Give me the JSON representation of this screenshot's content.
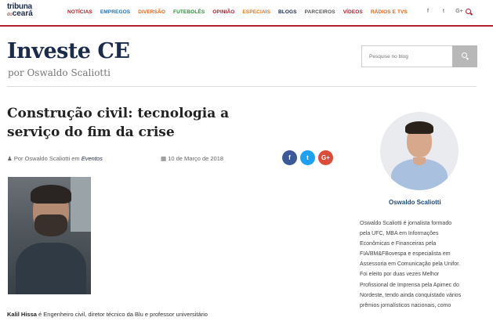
{
  "logo": {
    "line1": "tribuna",
    "line2_small": "do",
    "line2": "ceará"
  },
  "nav": [
    {
      "label": "NOTÍCIAS",
      "color": "#b2202b"
    },
    {
      "label": "EMPREGOS",
      "color": "#1f6fb5"
    },
    {
      "label": "DIVERSÃO",
      "color": "#e0661b"
    },
    {
      "label": "FUTEBOLÊS",
      "color": "#2a8c3a"
    },
    {
      "label": "OPINIÃO",
      "color": "#b2202b"
    },
    {
      "label": "ESPECIAIS",
      "color": "#e07a1b"
    },
    {
      "label": "BLOGS",
      "color": "#1b2b4a"
    },
    {
      "label": "PARCEIROS",
      "color": "#555555"
    },
    {
      "label": "VÍDEOS",
      "color": "#b2202b"
    },
    {
      "label": "RÁDIOS E TVS",
      "color": "#e0661b"
    }
  ],
  "social_top": [
    "f",
    "t",
    "G+"
  ],
  "blog": {
    "title": "Investe CE",
    "subtitle": "por Oswaldo Scaliotti"
  },
  "search": {
    "placeholder": "Pesquise no blog"
  },
  "article": {
    "title": "Construção civil: tecnologia a serviço do fim da crise",
    "author_prefix": "Por Oswaldo Scaliotti em",
    "category": "Eventos",
    "date": "10 de Março de 2018",
    "share": [
      {
        "label": "f",
        "color": "#3b5998"
      },
      {
        "label": "t",
        "color": "#1da1f2"
      },
      {
        "label": "G+",
        "color": "#dd4b39"
      }
    ],
    "caption_name": "Kalil Hissa",
    "caption_text": " é Engenheiro civil, diretor técnico da Blu e professor universitário"
  },
  "sidebar": {
    "name": "Oswaldo Scaliotti",
    "bio_lines": [
      "Oswaldo Scaliotti é jornalista formado",
      "pela UFC, MBA em Informações",
      "Econômicas e Financeiras pela",
      "FIA/BM&FBovespa e especialista em",
      "Assessoria em Comunicação pela Unifor.",
      "Foi eleito por duas vezes Melhor",
      "Profissional de Imprensa pela Apimec do",
      "Nordeste, tendo ainda conquistado vários",
      "prêmios jornalísticos nacionais, como"
    ]
  }
}
